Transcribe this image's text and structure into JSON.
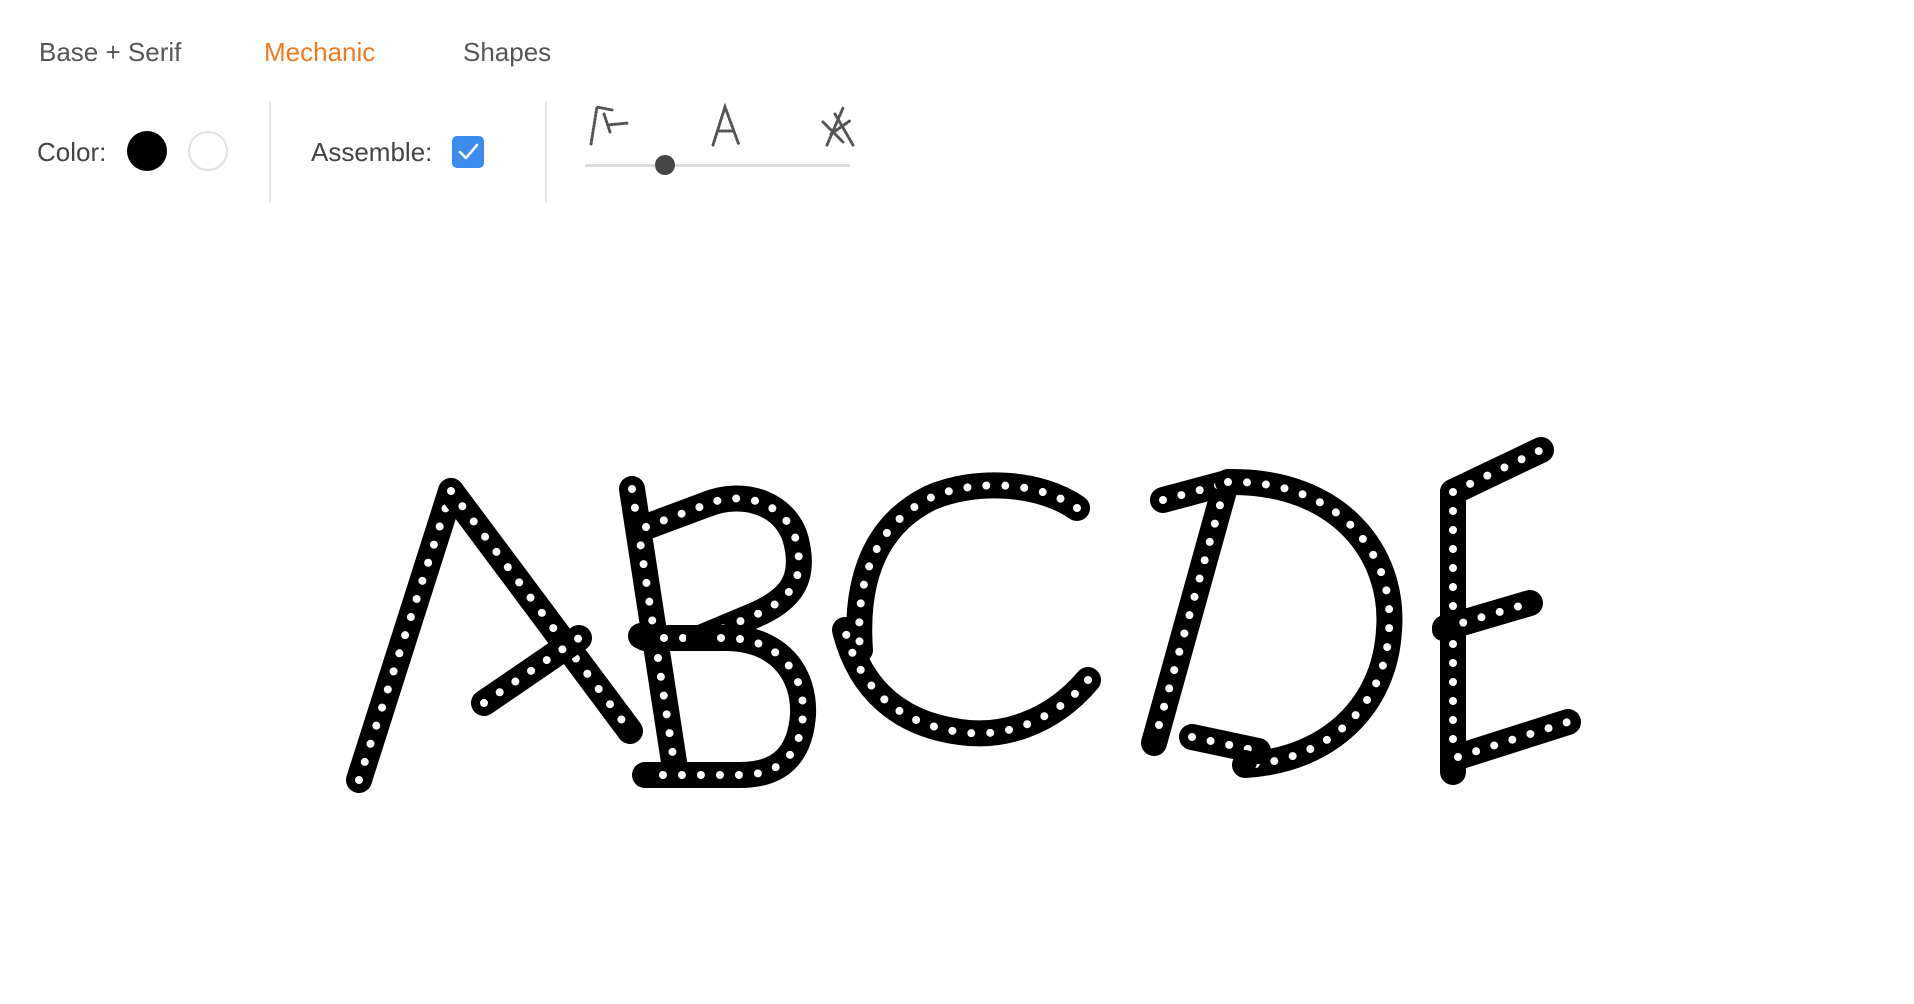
{
  "tabs": [
    {
      "label": "Base + Serif",
      "active": false
    },
    {
      "label": "Mechanic",
      "active": true
    },
    {
      "label": "Shapes",
      "active": false
    }
  ],
  "accent_color": "#ef7a22",
  "toolbar": {
    "color_label": "Color:",
    "color_options": [
      {
        "name": "black",
        "value": "#000000",
        "selected": true
      },
      {
        "name": "white",
        "value": "#ffffff",
        "selected": false
      }
    ],
    "assemble_label": "Assemble:",
    "assemble_checked": true,
    "checkbox_color": "#3b8cee",
    "slider": {
      "icons": [
        "disassembled-a-icon",
        "assembled-a-icon",
        "exploded-a-icon"
      ],
      "value": 0.3
    }
  },
  "canvas": {
    "text": "ABCDE",
    "stroke_color": "#000000",
    "dot_color": "#ffffff"
  }
}
